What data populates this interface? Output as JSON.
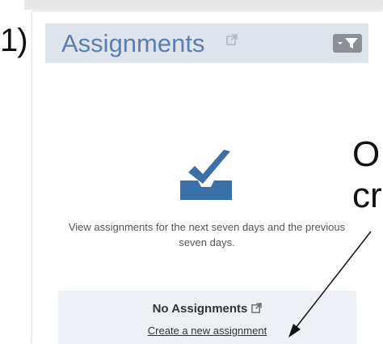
{
  "annotation": {
    "step_label": "1)",
    "side_text_line1": "O",
    "side_text_line2": "cr"
  },
  "widget": {
    "title": "Assignments",
    "title_icon": "external-link-icon",
    "filter_icon": "filter-icon",
    "empty_state": {
      "icon": "inbox-check-icon",
      "description": "View assignments for the next seven days and the previous seven days."
    },
    "footer": {
      "status": "No Assignments",
      "status_icon": "external-link-icon",
      "create_link": "Create a new assignment"
    }
  },
  "colors": {
    "header_bg": "#dde4ec",
    "title_color": "#5a7fae",
    "icon_blue": "#3b6fa8",
    "footer_bg": "#edf1f5",
    "filter_button_bg": "#8a9096"
  }
}
